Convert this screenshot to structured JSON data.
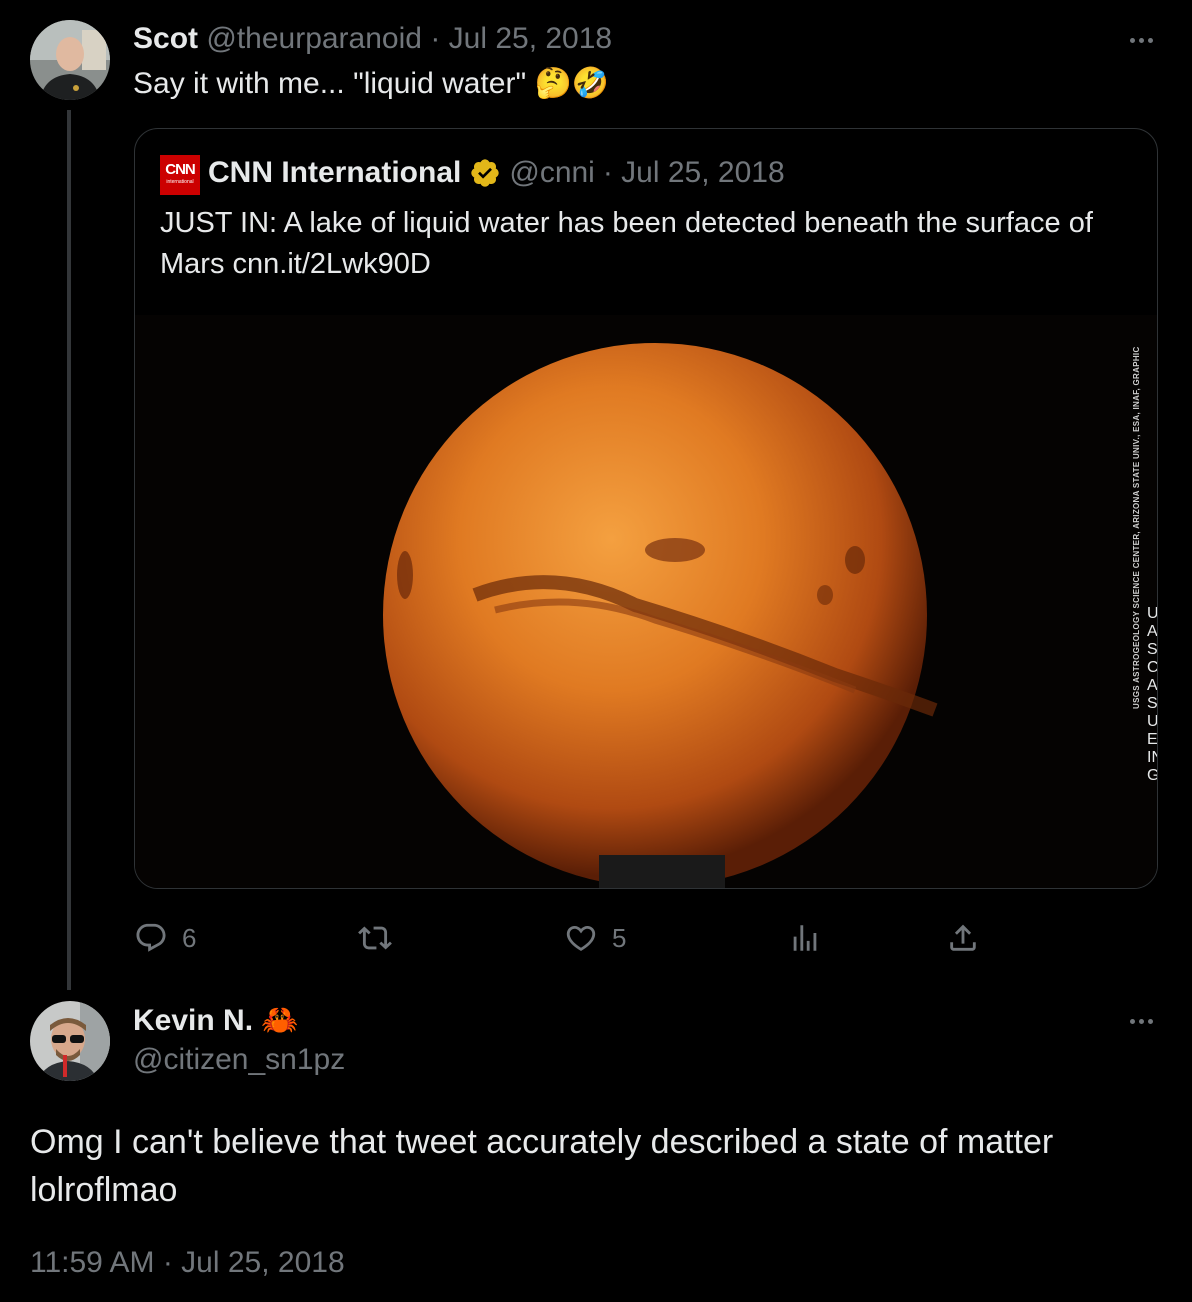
{
  "parent_tweet": {
    "display_name": "Scot",
    "handle": "@theurparanoid",
    "date": "· Jul 25, 2018",
    "text": "Say it with me... \"liquid water\" 🤔🤣"
  },
  "quoted_tweet": {
    "display_name": "CNN International",
    "handle": "@cnni",
    "date": "· Jul 25, 2018",
    "logo_text": "CNN",
    "logo_subtext": "international",
    "text": "JUST IN: A lake of liquid water has been detected beneath the surface of Mars cnn.it/2Lwk90D",
    "image_credit": "USGS ASTROGEOLOGY SCIENCE CENTER, ARIZONA STATE UNIV., ESA, INAF, GRAPHIC",
    "verified_color": "#e2b719"
  },
  "actions": {
    "reply_count": "6",
    "retweet_count": "",
    "like_count": "5"
  },
  "reply_tweet": {
    "display_name": "Kevin N.",
    "name_emoji": "🦀",
    "handle": "@citizen_sn1pz",
    "text": "Omg I can't believe that tweet accurately described a state of matter lolroflmao",
    "timestamp": "11:59 AM · Jul 25, 2018"
  },
  "icons": [
    "more-icon",
    "reply-icon",
    "retweet-icon",
    "like-icon",
    "views-icon",
    "share-icon",
    "verified-icon"
  ]
}
